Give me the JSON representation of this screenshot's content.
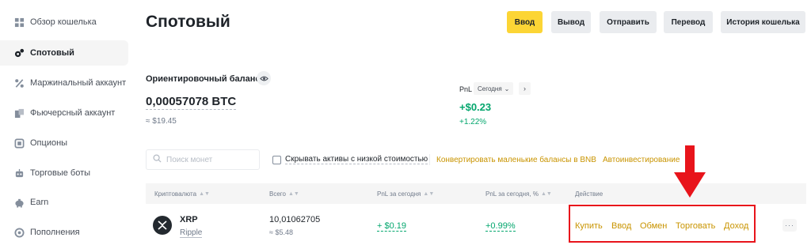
{
  "sidebar": {
    "items": [
      {
        "label": "Обзор кошелька",
        "icon": "grid-icon"
      },
      {
        "label": "Спотовый",
        "icon": "spot-icon",
        "active": true
      },
      {
        "label": "Маржинальный аккаунт",
        "icon": "percent-icon"
      },
      {
        "label": "Фьючерсный аккаунт",
        "icon": "futures-icon"
      },
      {
        "label": "Опционы",
        "icon": "options-icon"
      },
      {
        "label": "Торговые боты",
        "icon": "bot-icon"
      },
      {
        "label": "Earn",
        "icon": "piggy-bank-icon"
      },
      {
        "label": "Пополнения",
        "icon": "deposit-icon"
      }
    ]
  },
  "header": {
    "title": "Спотовый",
    "buttons": {
      "deposit": "Ввод",
      "withdraw": "Вывод",
      "send": "Отправить",
      "transfer": "Перевод",
      "history": "История кошелька"
    }
  },
  "balance": {
    "label": "Ориентировочный баланс",
    "value": "0,00057078 BTC",
    "usd": "≈ $19.45"
  },
  "pnl": {
    "label": "PnL",
    "period": "Сегодня",
    "value": "+$0.23",
    "percent": "+1.22%"
  },
  "filters": {
    "search_placeholder": "Поиск монет",
    "hide_small_label": "Скрывать активы с низкой стоимостью",
    "convert_link": "Конвертировать маленькие балансы в BNB",
    "auto_invest_link": "Автоинвестирование"
  },
  "table": {
    "headers": {
      "crypto": "Криптовалюта",
      "total": "Всего",
      "pnl_today": "PnL за сегодня",
      "pnl_today_pct": "PnL за сегодня, %",
      "action": "Действие"
    },
    "rows": [
      {
        "symbol": "XRP",
        "name": "Ripple",
        "icon": "xrp-icon",
        "total": "10,01062705",
        "total_usd": "≈ $5.48",
        "pnl": "+ $0.19",
        "pnl_pct": "+0.99%",
        "actions": {
          "buy": "Купить",
          "deposit": "Ввод",
          "exchange": "Обмен",
          "trade": "Торговать",
          "income": "Доход"
        },
        "more": "···"
      }
    ]
  },
  "colors": {
    "accent": "#fcd535",
    "link": "#c99400",
    "positive": "#03a66d",
    "highlight": "#e8141b"
  }
}
